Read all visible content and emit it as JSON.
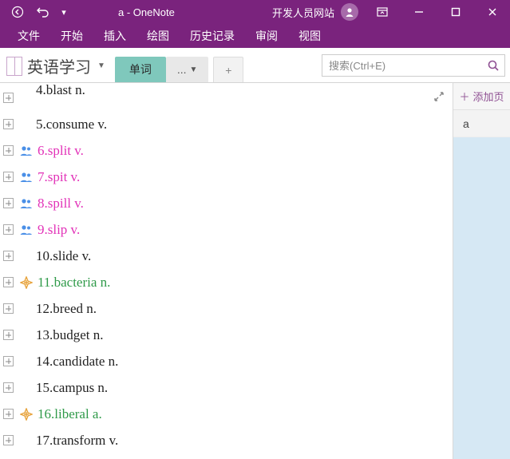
{
  "titlebar": {
    "title": "a  -  OneNote",
    "right_text": "开发人员网站"
  },
  "menu": [
    "文件",
    "开始",
    "插入",
    "绘图",
    "历史记录",
    "审阅",
    "视图"
  ],
  "notebook": {
    "name": "英语学习"
  },
  "sections": {
    "active": "单词",
    "more": "...",
    "add": "+"
  },
  "search": {
    "placeholder": "搜索(Ctrl+E)"
  },
  "sidepanel": {
    "add_label": "添加页",
    "pages": [
      "a"
    ]
  },
  "lines": [
    {
      "text": "4.blast n.",
      "color": "black",
      "icon": null,
      "cut": true
    },
    {
      "text": "5.consume v.",
      "color": "black",
      "icon": null
    },
    {
      "text": "6.split v.",
      "color": "magenta",
      "icon": "people"
    },
    {
      "text": "7.spit v.",
      "color": "magenta",
      "icon": "people"
    },
    {
      "text": "8.spill v.",
      "color": "magenta",
      "icon": "people"
    },
    {
      "text": "9.slip v.",
      "color": "magenta",
      "icon": "people"
    },
    {
      "text": "10.slide v.",
      "color": "black",
      "icon": null
    },
    {
      "text": "11.bacteria n.",
      "color": "green",
      "icon": "star"
    },
    {
      "text": "12.breed n.",
      "color": "black",
      "icon": null
    },
    {
      "text": "13.budget n.",
      "color": "black",
      "icon": null
    },
    {
      "text": "14.candidate n.",
      "color": "black",
      "icon": null
    },
    {
      "text": "15.campus n.",
      "color": "black",
      "icon": null
    },
    {
      "text": "16.liberal a.",
      "color": "green",
      "icon": "star"
    },
    {
      "text": "17.transform v.",
      "color": "black",
      "icon": null
    }
  ]
}
